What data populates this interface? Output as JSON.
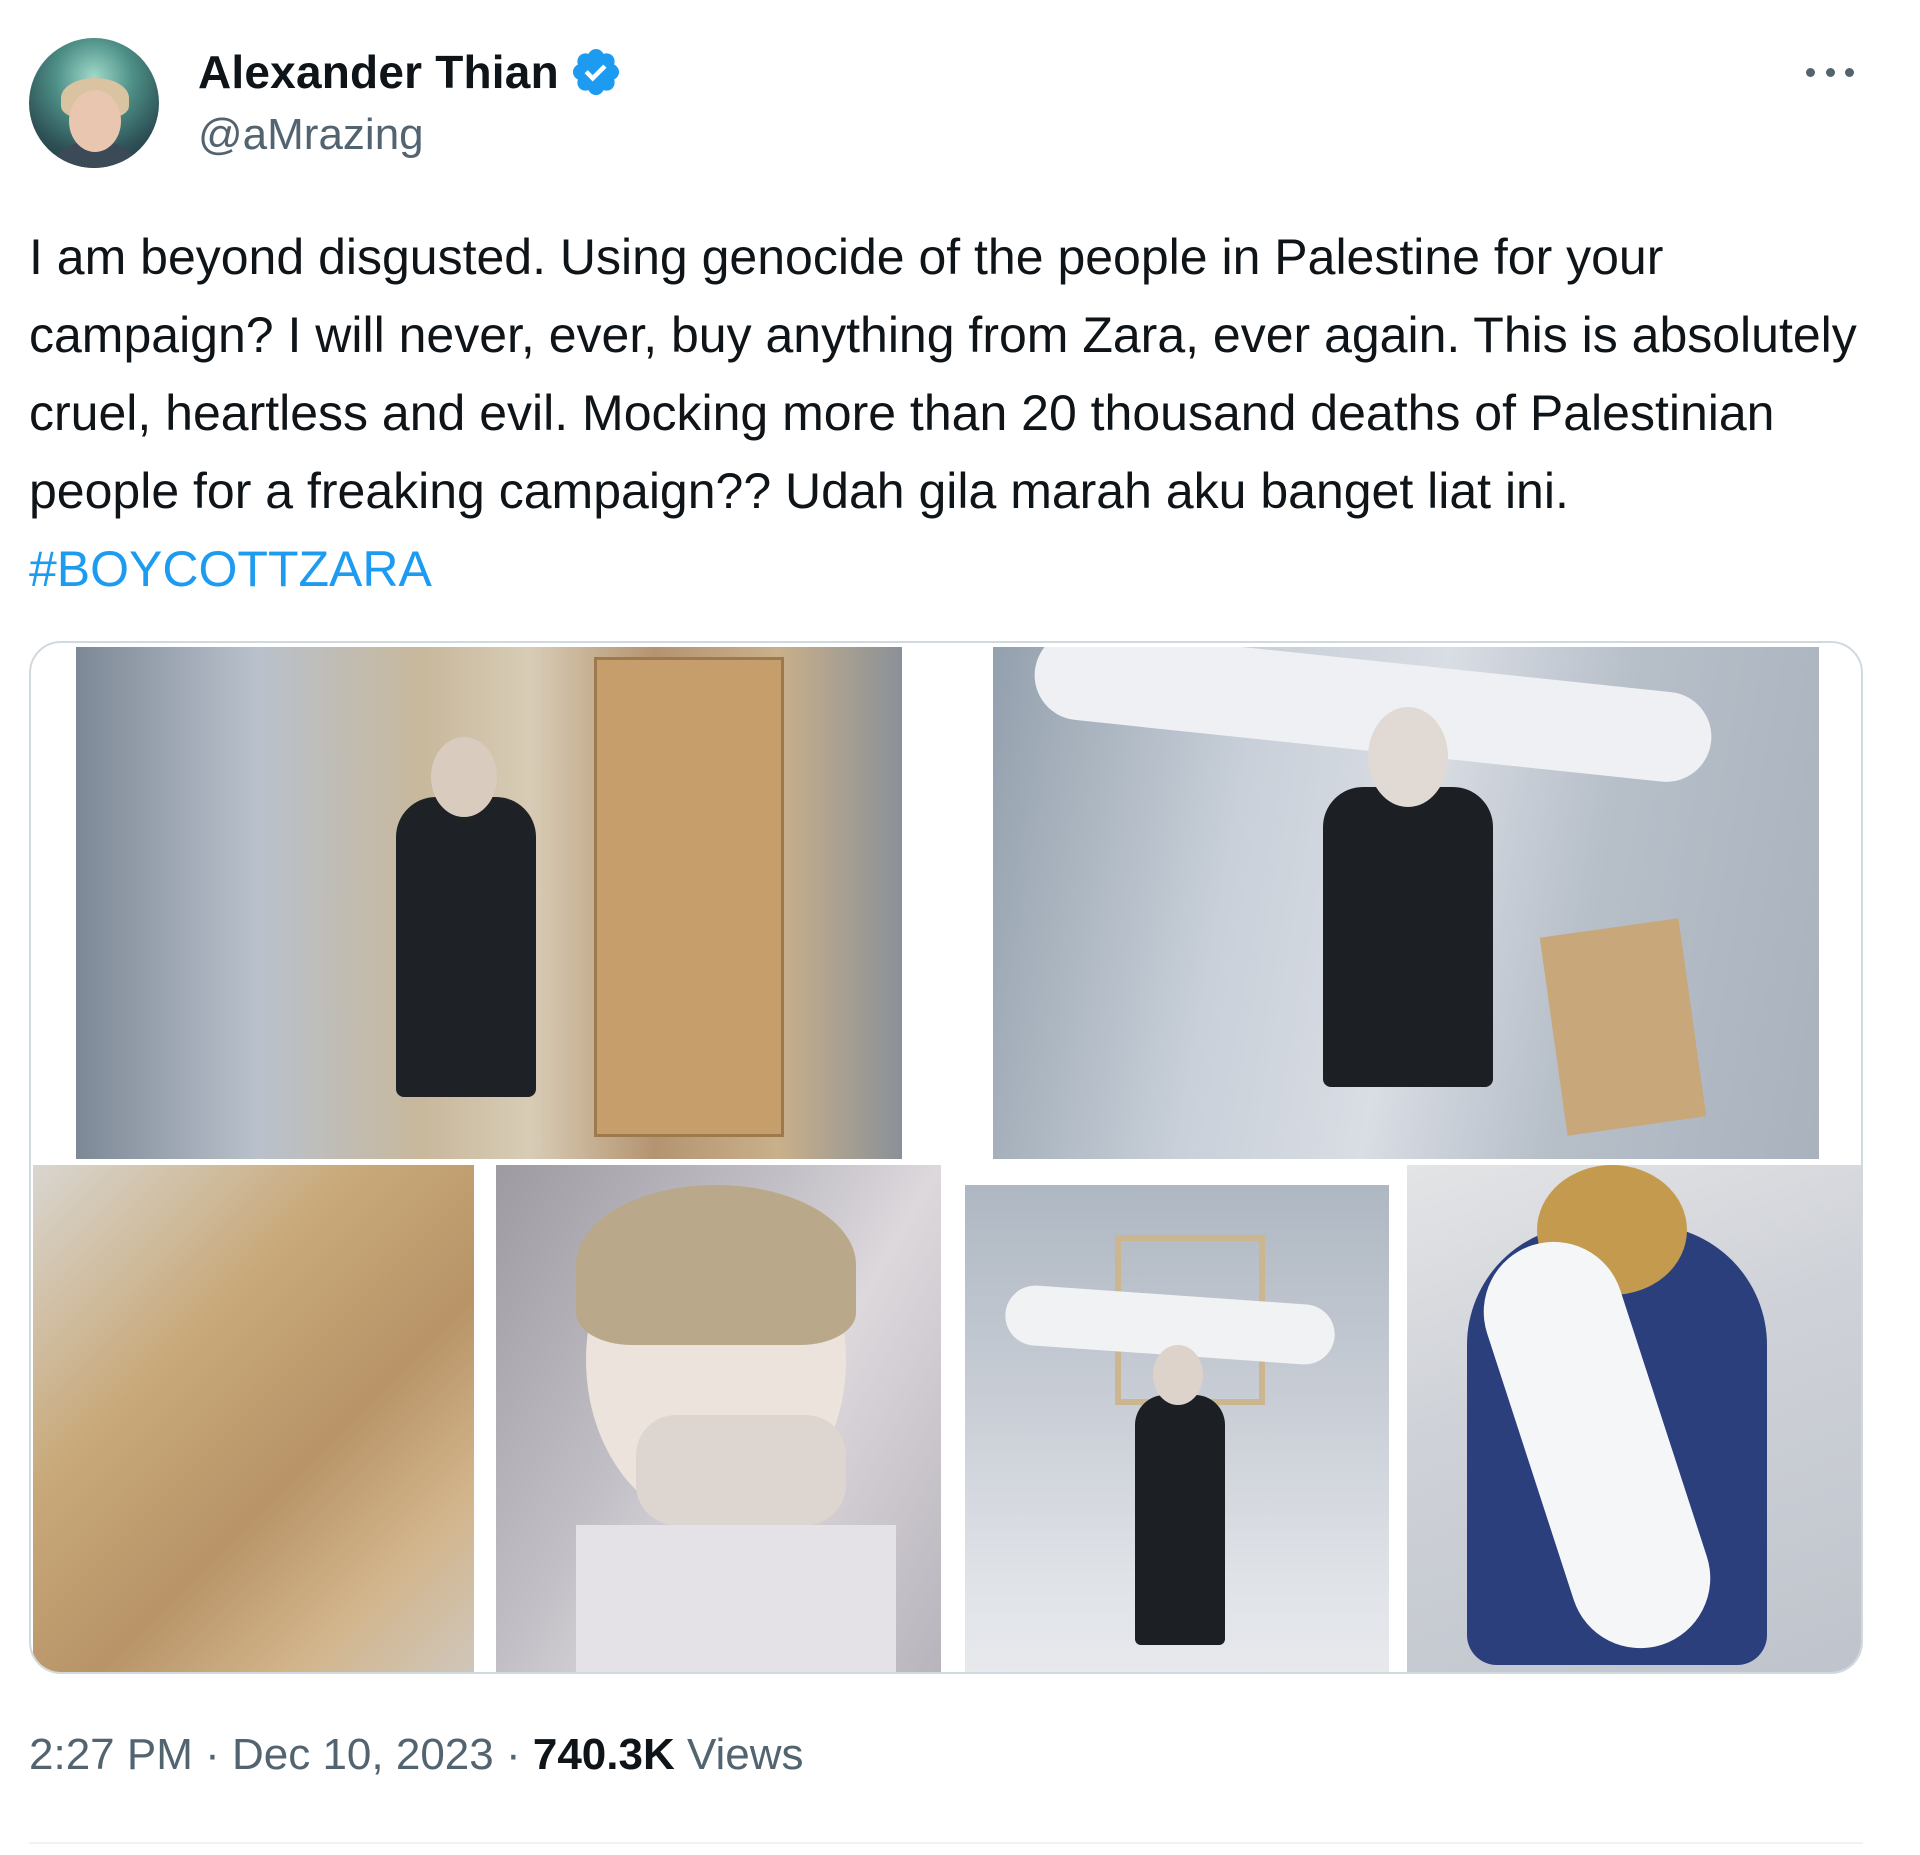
{
  "author": {
    "display_name": "Alexander Thian",
    "handle": "@aMrazing",
    "verified": true
  },
  "tweet": {
    "text": "I am beyond disgusted. Using genocide of the people in Palestine for your campaign? I will never, ever, buy anything from Zara, ever again. This is absolutely cruel, heartless and evil. Mocking more than 20 thousand deaths of Palestinian people for a freaking campaign?? Udah gila marah aku banget liat ini.",
    "hashtag": "#BOYCOTTZARA"
  },
  "media": {
    "image_count": 6
  },
  "meta": {
    "time": "2:27 PM",
    "separator_1": " · ",
    "date": "Dec 10, 2023",
    "separator_2": " · ",
    "views_count": "740.3K",
    "views_label": " Views"
  },
  "colors": {
    "accent": "#1d9bf0",
    "text_primary": "#0f1419",
    "text_secondary": "#536471",
    "border": "#cfd9de"
  },
  "icons": {
    "verified": "verified-badge-icon",
    "more": "more-options-icon"
  }
}
